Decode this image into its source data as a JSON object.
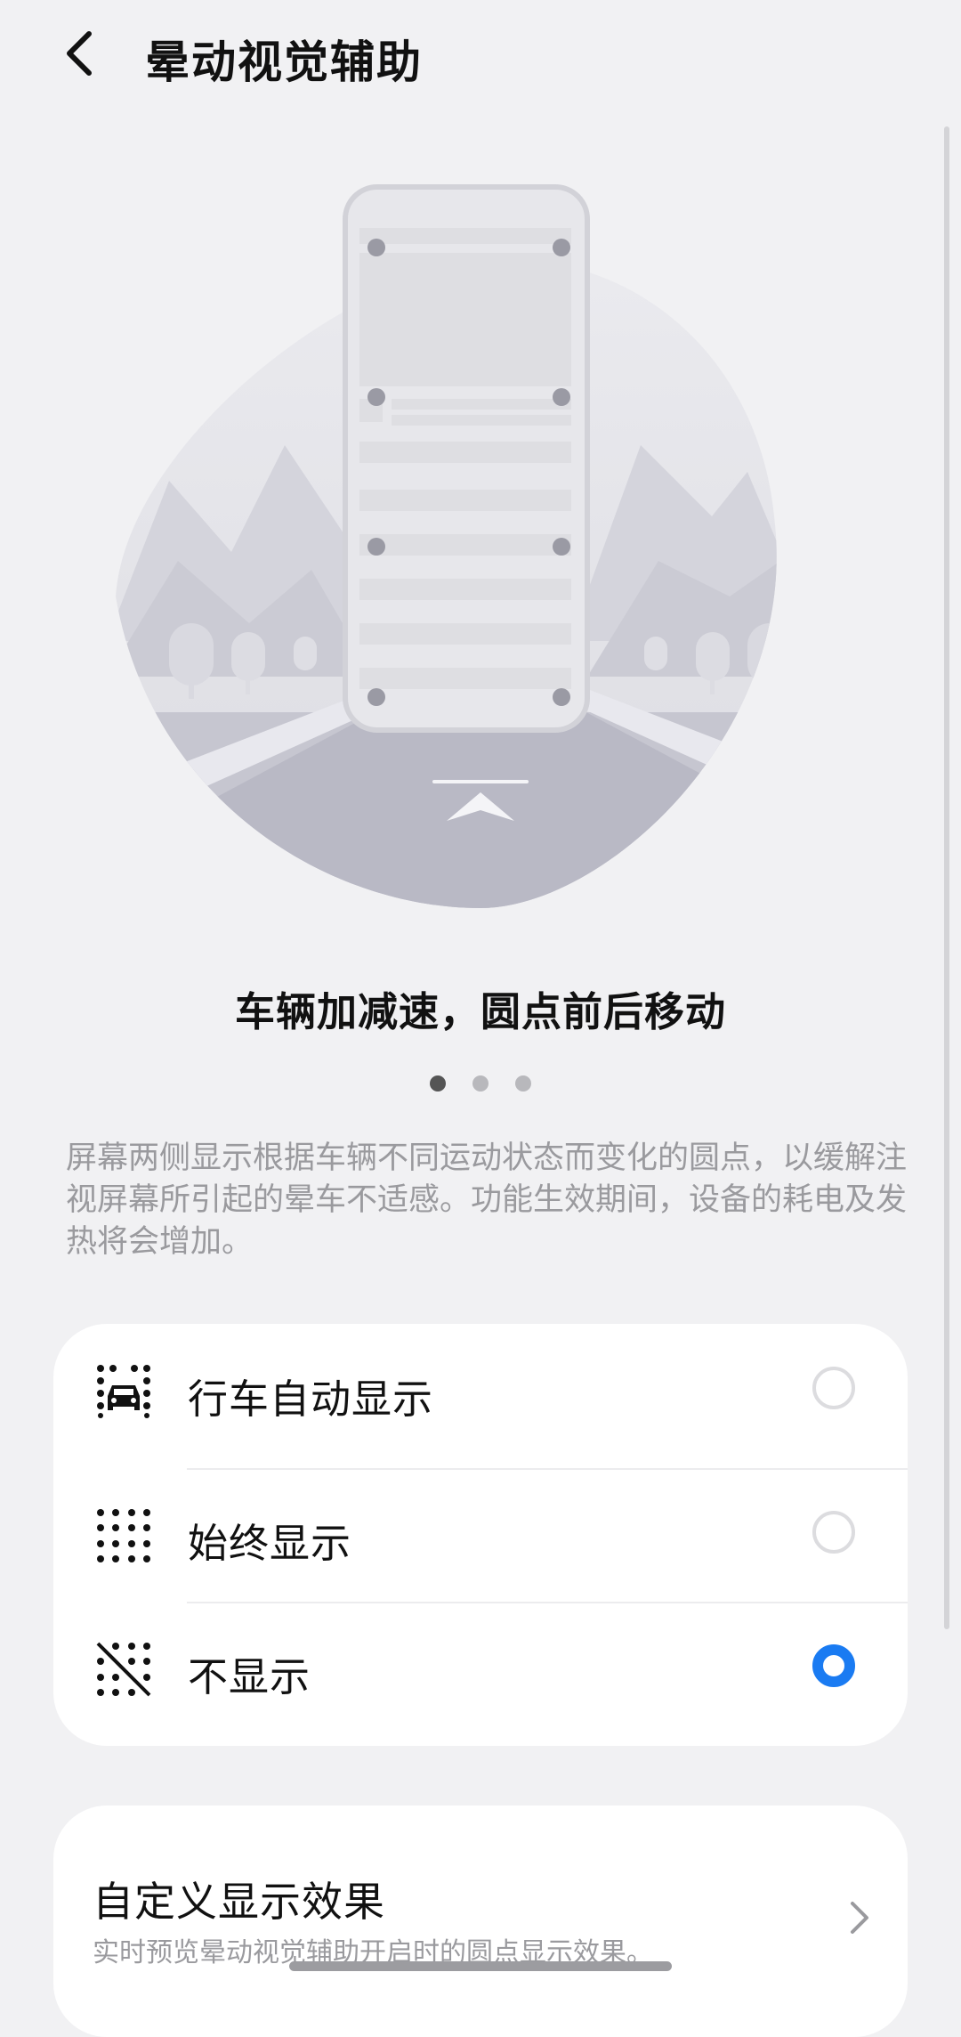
{
  "header": {
    "title": "晕动视觉辅助",
    "back_icon": "chevron-left-icon"
  },
  "illustration": {
    "icon": "phone-road-illustration"
  },
  "carousel": {
    "caption": "车辆加减速，圆点前后移动",
    "page_count": 3,
    "active_page": 1
  },
  "description": "屏幕两侧显示根据车辆不同运动状态而变化的圆点，以缓解注视屏幕所引起的晕车不适感。功能生效期间，设备的耗电及发热将会增加。",
  "options": [
    {
      "label": "行车自动显示",
      "icon": "car-dots-icon",
      "selected": false
    },
    {
      "label": "始终显示",
      "icon": "dots-grid-icon",
      "selected": false
    },
    {
      "label": "不显示",
      "icon": "dots-off-icon",
      "selected": true
    }
  ],
  "custom": {
    "title": "自定义显示效果",
    "subtitle": "实时预览晕动视觉辅助开启时的圆点显示效果。",
    "chevron_icon": "chevron-right-icon"
  },
  "colors": {
    "background": "#f1f1f3",
    "accent": "#1a7bf2",
    "card": "#ffffff",
    "secondary_text": "#9a9a9e"
  }
}
